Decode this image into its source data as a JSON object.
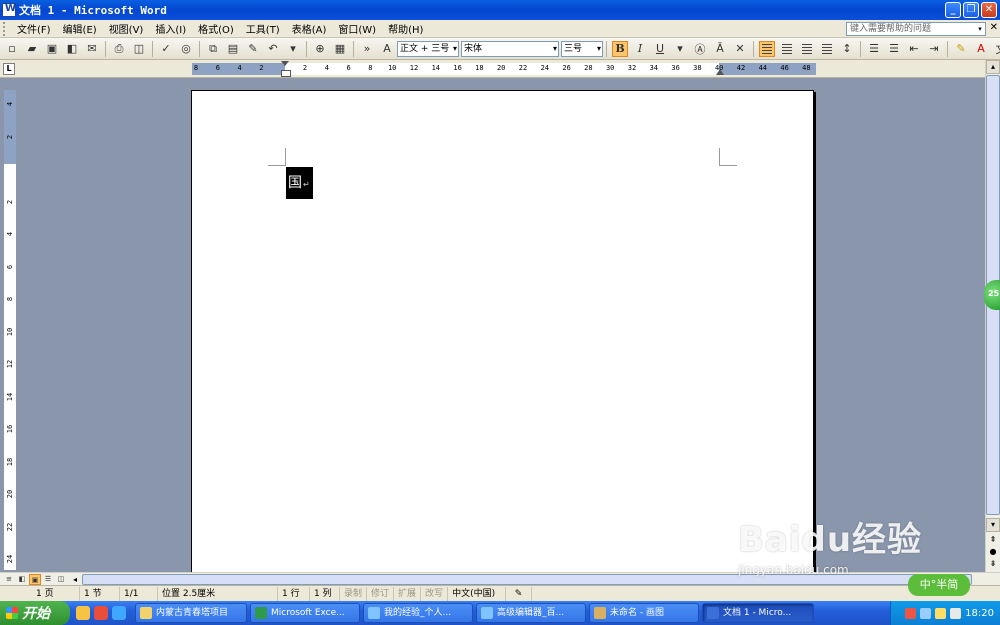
{
  "window": {
    "title": "文档 1 - Microsoft Word",
    "controls": [
      "_",
      "❐",
      "✕"
    ]
  },
  "menubar": {
    "items": [
      "文件(F)",
      "编辑(E)",
      "视图(V)",
      "插入(I)",
      "格式(O)",
      "工具(T)",
      "表格(A)",
      "窗口(W)",
      "帮助(H)"
    ],
    "help_placeholder": "键入需要帮助的问题"
  },
  "toolbar": {
    "style_value": "正文 + 三号",
    "font_value": "宋体",
    "size_value": "三号",
    "bold_label": "B",
    "italic_label": "I",
    "underline_label": "U"
  },
  "ruler": {
    "ticks": [
      "8",
      "6",
      "4",
      "2",
      "",
      "2",
      "4",
      "6",
      "8",
      "10",
      "12",
      "14",
      "16",
      "18",
      "20",
      "22",
      "24",
      "26",
      "28",
      "30",
      "32",
      "34",
      "36",
      "38",
      "40",
      "42",
      "44",
      "46",
      "48"
    ]
  },
  "vruler": {
    "ticks": [
      "4",
      "2",
      "",
      "2",
      "4",
      "6",
      "8",
      "10",
      "12",
      "14",
      "16",
      "18",
      "20",
      "22",
      "24"
    ]
  },
  "document": {
    "char": "国",
    "para_mark": "↵"
  },
  "statusbar": {
    "page": "1 页",
    "section": "1 节",
    "page_of": "1/1",
    "position": "位置 2.5厘米",
    "line": "1 行",
    "column": "1 列",
    "rec": "录制",
    "trk": "修订",
    "ext": "扩展",
    "ovr": "改写",
    "language": "中文(中国)"
  },
  "watermark": {
    "logo": "Baidu经验",
    "url": "jingyan.baidu.com"
  },
  "ime": {
    "label": "中°半简"
  },
  "scroll_badge": "25",
  "taskbar": {
    "start": "开始",
    "tasks": [
      {
        "label": "内蒙古青春塔项目",
        "active": false
      },
      {
        "label": "Microsoft Exce...",
        "active": false
      },
      {
        "label": "我的经验_个人...",
        "active": false
      },
      {
        "label": "高级编辑器_百...",
        "active": false
      },
      {
        "label": "未命名 - 画图",
        "active": false
      },
      {
        "label": "文档 1 - Micro...",
        "active": true
      }
    ],
    "clock": "18:20"
  }
}
